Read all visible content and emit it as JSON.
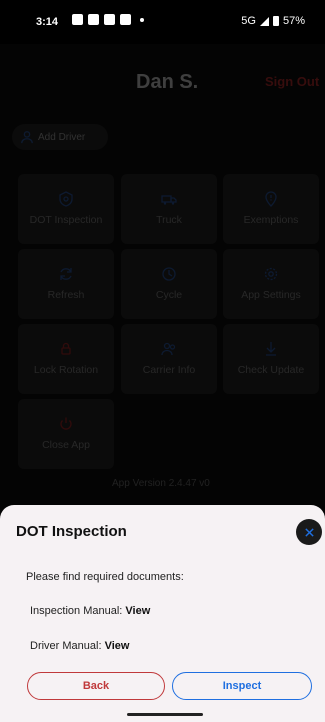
{
  "status_bar": {
    "time": "3:14",
    "network": "5G",
    "battery": "57%"
  },
  "header": {
    "driver_name": "Dan S.",
    "sign_out_label": "Sign Out"
  },
  "add_driver_label": "Add Driver",
  "tiles": [
    {
      "label": "DOT Inspection",
      "icon": "shield-badge-icon"
    },
    {
      "label": "Truck",
      "icon": "truck-icon"
    },
    {
      "label": "Exemptions",
      "icon": "alert-pin-icon"
    },
    {
      "label": "Refresh",
      "icon": "refresh-icon"
    },
    {
      "label": "Cycle",
      "icon": "cycle-clock-icon"
    },
    {
      "label": "App Settings",
      "icon": "settings-gear-icon"
    },
    {
      "label": "Lock Rotation",
      "icon": "lock-rotation-icon"
    },
    {
      "label": "Carrier Info",
      "icon": "carrier-people-icon"
    },
    {
      "label": "Check Update",
      "icon": "download-arrow-icon"
    },
    {
      "label": "Close App",
      "icon": "power-icon"
    }
  ],
  "app_version_text": "App Version 2.4.47 v0",
  "sheet": {
    "title": "DOT Inspection",
    "prompt": "Please find required documents:",
    "inspection_manual_label": "Inspection Manual:",
    "driver_manual_label": "Driver Manual:",
    "view_label": "View",
    "back_label": "Back",
    "inspect_label": "Inspect"
  },
  "colors": {
    "accent_blue": "#1f6fe0",
    "accent_red": "#c0393b",
    "tile_icon_blue": "#1e3a6b",
    "tile_icon_red": "#6b1a1a"
  }
}
